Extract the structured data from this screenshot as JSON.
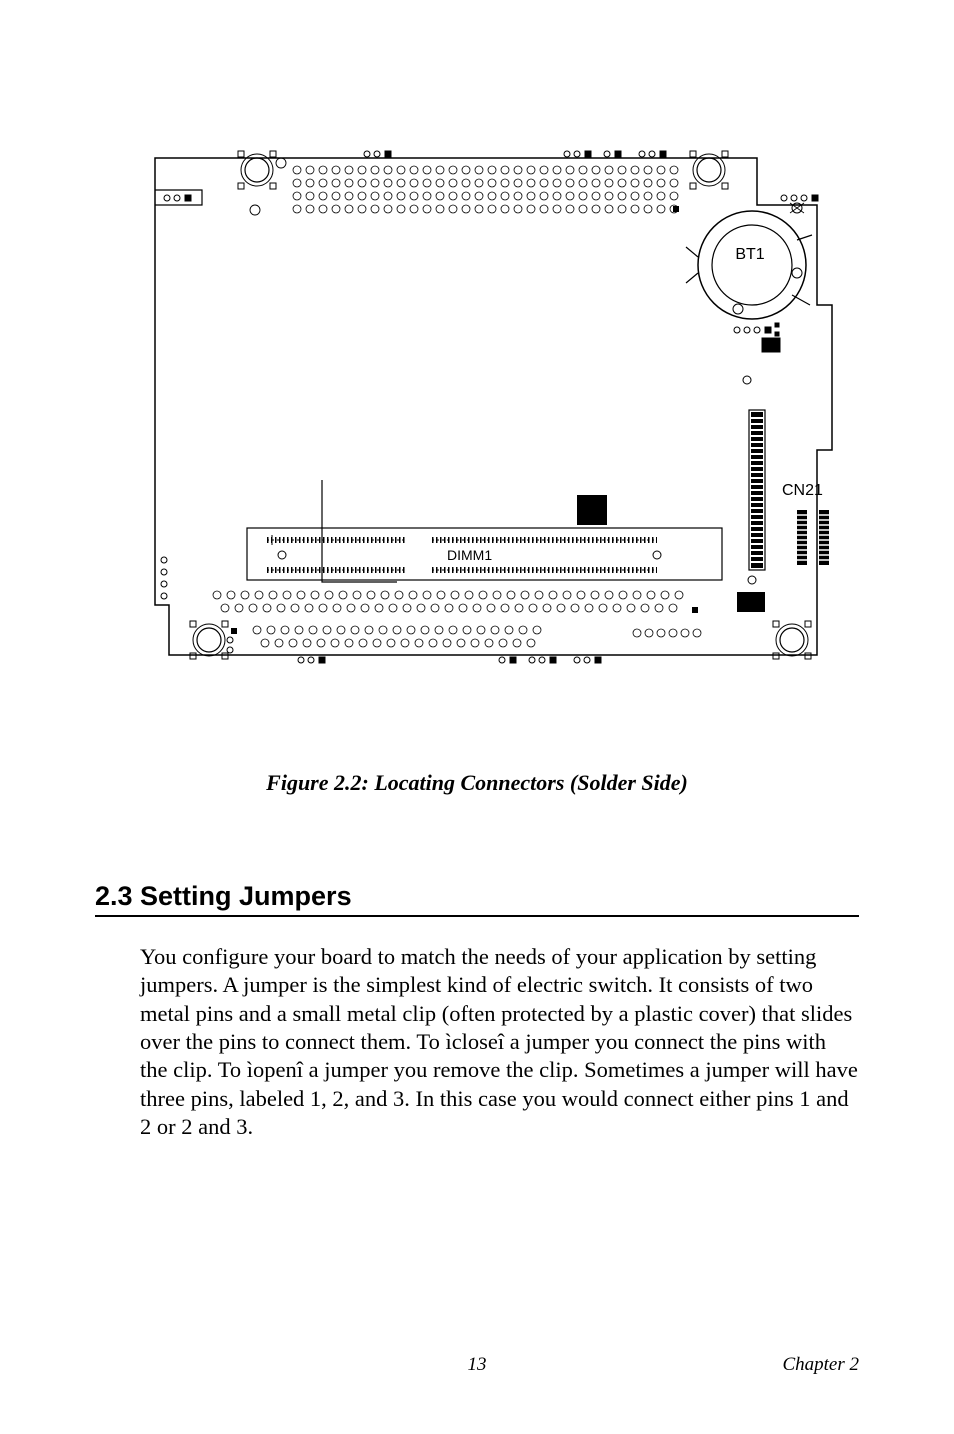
{
  "diagram": {
    "labels": {
      "bt1": "BT1",
      "cn21": "CN21",
      "dimm1": "DIMM1"
    }
  },
  "caption": "Figure 2.2: Locating Connectors (Solder Side)",
  "heading": "2.3  Setting Jumpers",
  "body": "You configure your board to match the needs of your application by setting jumpers. A jumper is the simplest kind of electric switch. It consists of two metal pins and a small metal clip (often protected by a plastic cover) that slides over the pins to connect them. To ìcloseî a jumper you connect the pins with the clip. To ìopenî a jumper you remove the clip. Sometimes a jumper will have three pins, labeled 1, 2, and 3. In this case you would connect either pins 1 and 2 or 2 and 3.",
  "footer": {
    "page": "13",
    "chapter": "Chapter 2"
  }
}
